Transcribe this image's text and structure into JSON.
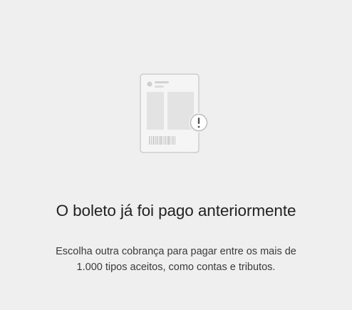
{
  "empty_state": {
    "illustration_icon": "boleto-warning-icon",
    "title": "O boleto já foi pago anteriormente",
    "description_line1": "Escolha outra cobrança para pagar entre os mais de",
    "description_line2": "1.000 tipos aceitos, como contas e tributos."
  },
  "colors": {
    "background": "#efefef",
    "title_text": "#222222",
    "body_text": "#3a3a3a",
    "illustration_stroke": "#c8c8c8",
    "illustration_fill": "#e6e6e6"
  }
}
